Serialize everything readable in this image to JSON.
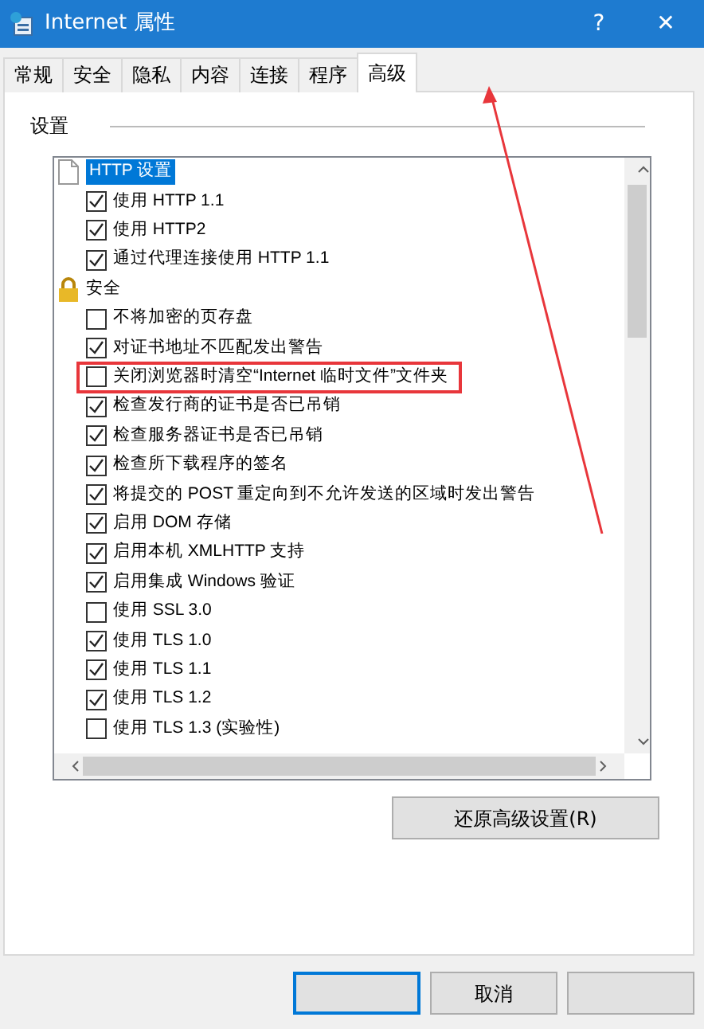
{
  "window": {
    "title": "Internet 属性",
    "help": "?",
    "close": "✕"
  },
  "tabs": [
    {
      "label": "常规",
      "selected": false
    },
    {
      "label": "安全",
      "selected": false
    },
    {
      "label": "隐私",
      "selected": false
    },
    {
      "label": "内容",
      "selected": false
    },
    {
      "label": "连接",
      "selected": false
    },
    {
      "label": "程序",
      "selected": false
    },
    {
      "label": "高级",
      "selected": true
    }
  ],
  "settings_label": "设置",
  "settings": [
    {
      "kind": "pagegroup",
      "label": "HTTP 设置",
      "selected": true,
      "children": [
        {
          "kind": "checkbox",
          "label": "使用 HTTP 1.1",
          "checked": true,
          "highlighted": false
        },
        {
          "kind": "checkbox",
          "label": "使用 HTTP2",
          "checked": true,
          "highlighted": false
        },
        {
          "kind": "checkbox",
          "label": "通过代理连接使用 HTTP 1.1",
          "checked": true,
          "highlighted": false
        }
      ]
    },
    {
      "kind": "lockgroup",
      "label": "安全",
      "selected": false,
      "children": [
        {
          "kind": "checkbox",
          "label": "不将加密的页存盘",
          "checked": false,
          "highlighted": false
        },
        {
          "kind": "checkbox",
          "label": "对证书地址不匹配发出警告",
          "checked": true,
          "highlighted": false
        },
        {
          "kind": "checkbox",
          "label": "关闭浏览器时清空“Internet 临时文件”文件夹",
          "checked": false,
          "highlighted": true
        },
        {
          "kind": "checkbox",
          "label": "检查发行商的证书是否已吊销",
          "checked": true,
          "highlighted": false
        },
        {
          "kind": "checkbox",
          "label": "检查服务器证书是否已吊销",
          "checked": true,
          "highlighted": false
        },
        {
          "kind": "checkbox",
          "label": "检查所下载程序的签名",
          "checked": true,
          "highlighted": false
        },
        {
          "kind": "checkbox",
          "label": "将提交的 POST 重定向到不允许发送的区域时发出警告",
          "checked": true,
          "highlighted": false
        },
        {
          "kind": "checkbox",
          "label": "启用 DOM 存储",
          "checked": true,
          "highlighted": false
        },
        {
          "kind": "checkbox",
          "label": "启用本机 XMLHTTP 支持",
          "checked": true,
          "highlighted": false
        },
        {
          "kind": "checkbox",
          "label": "启用集成 Windows 验证",
          "checked": true,
          "highlighted": false
        },
        {
          "kind": "checkbox",
          "label": "使用 SSL 3.0",
          "checked": false,
          "highlighted": false
        },
        {
          "kind": "checkbox",
          "label": "使用 TLS 1.0",
          "checked": true,
          "highlighted": false
        },
        {
          "kind": "checkbox",
          "label": "使用 TLS 1.1",
          "checked": true,
          "highlighted": false
        },
        {
          "kind": "checkbox",
          "label": "使用 TLS 1.2",
          "checked": true,
          "highlighted": false
        },
        {
          "kind": "checkbox",
          "label": "使用 TLS 1.3 (实验性)",
          "checked": false,
          "highlighted": false
        }
      ]
    }
  ],
  "restore_button": "还原高级设置(R)",
  "footer_buttons": [
    {
      "default": true
    },
    {
      "label": "取消",
      "default": false
    },
    {
      "default": false
    }
  ]
}
